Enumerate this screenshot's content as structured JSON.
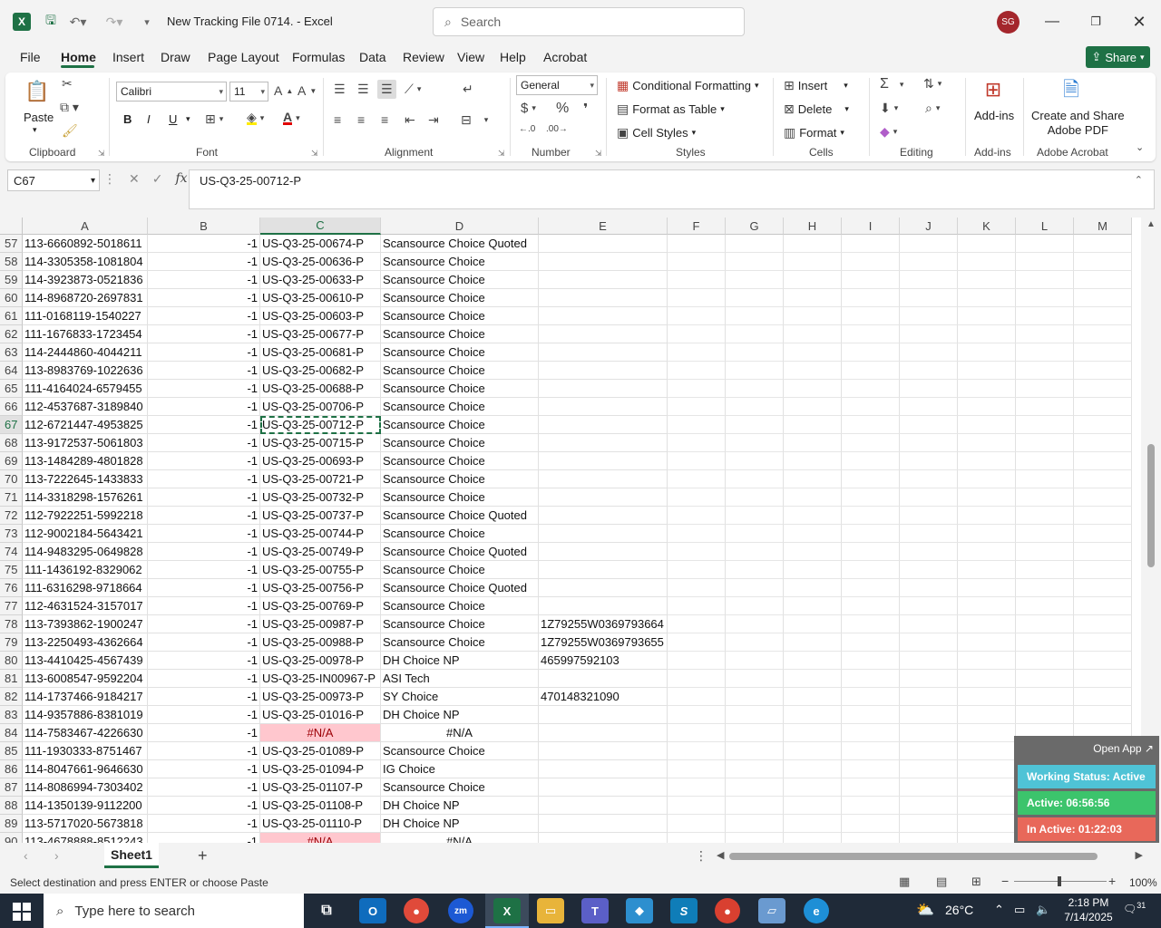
{
  "titlebar": {
    "doc_title": "New Tracking File 0714.  -  Excel",
    "search_placeholder": "Search",
    "avatar": "SG"
  },
  "menu": [
    "File",
    "Home",
    "Insert",
    "Draw",
    "Page Layout",
    "Formulas",
    "Data",
    "Review",
    "View",
    "Help",
    "Acrobat"
  ],
  "share_label": "Share",
  "ribbon": {
    "clipboard": {
      "paste": "Paste",
      "label": "Clipboard"
    },
    "font": {
      "name": "Calibri",
      "size": "11",
      "bold": "B",
      "italic": "I",
      "underline": "U",
      "label": "Font"
    },
    "alignment": {
      "label": "Alignment"
    },
    "number": {
      "format": "General",
      "label": "Number"
    },
    "styles": {
      "conditional": "Conditional Formatting",
      "table": "Format as Table",
      "cell_styles": "Cell Styles",
      "label": "Styles"
    },
    "cells": {
      "insert": "Insert",
      "delete": "Delete",
      "format": "Format",
      "label": "Cells"
    },
    "editing": {
      "label": "Editing"
    },
    "addins": {
      "btn": "Add-ins",
      "label": "Add-ins"
    },
    "acrobat": {
      "btn_line1": "Create and Share",
      "btn_line2": "Adobe PDF",
      "label": "Adobe Acrobat"
    }
  },
  "formula_bar": {
    "name_box": "C67",
    "value": "US-Q3-25-00712-P"
  },
  "columns": [
    "A",
    "B",
    "C",
    "D",
    "E",
    "F",
    "G",
    "H",
    "I",
    "J",
    "K",
    "L",
    "M"
  ],
  "selected_cell": {
    "row": 67,
    "col": "C"
  },
  "rows": [
    {
      "n": "57",
      "a": "113-6660892-5018611",
      "b": "-1",
      "c": "US-Q3-25-00674-P",
      "d": "Scansource Choice Quoted",
      "e": ""
    },
    {
      "n": "58",
      "a": "114-3305358-1081804",
      "b": "-1",
      "c": "US-Q3-25-00636-P",
      "d": "Scansource Choice",
      "e": ""
    },
    {
      "n": "59",
      "a": "114-3923873-0521836",
      "b": "-1",
      "c": "US-Q3-25-00633-P",
      "d": "Scansource Choice",
      "e": ""
    },
    {
      "n": "60",
      "a": "114-8968720-2697831",
      "b": "-1",
      "c": "US-Q3-25-00610-P",
      "d": "Scansource Choice",
      "e": ""
    },
    {
      "n": "61",
      "a": "111-0168119-1540227",
      "b": "-1",
      "c": "US-Q3-25-00603-P",
      "d": "Scansource Choice",
      "e": ""
    },
    {
      "n": "62",
      "a": "111-1676833-1723454",
      "b": "-1",
      "c": "US-Q3-25-00677-P",
      "d": "Scansource Choice",
      "e": ""
    },
    {
      "n": "63",
      "a": "114-2444860-4044211",
      "b": "-1",
      "c": "US-Q3-25-00681-P",
      "d": "Scansource Choice",
      "e": ""
    },
    {
      "n": "64",
      "a": "113-8983769-1022636",
      "b": "-1",
      "c": "US-Q3-25-00682-P",
      "d": "Scansource Choice",
      "e": ""
    },
    {
      "n": "65",
      "a": "111-4164024-6579455",
      "b": "-1",
      "c": "US-Q3-25-00688-P",
      "d": "Scansource Choice",
      "e": ""
    },
    {
      "n": "66",
      "a": "112-4537687-3189840",
      "b": "-1",
      "c": "US-Q3-25-00706-P",
      "d": "Scansource Choice",
      "e": ""
    },
    {
      "n": "67",
      "a": "112-6721447-4953825",
      "b": "-1",
      "c": "US-Q3-25-00712-P",
      "d": "Scansource Choice",
      "e": ""
    },
    {
      "n": "68",
      "a": "113-9172537-5061803",
      "b": "-1",
      "c": "US-Q3-25-00715-P",
      "d": "Scansource Choice",
      "e": ""
    },
    {
      "n": "69",
      "a": "113-1484289-4801828",
      "b": "-1",
      "c": "US-Q3-25-00693-P",
      "d": "Scansource Choice",
      "e": ""
    },
    {
      "n": "70",
      "a": "113-7222645-1433833",
      "b": "-1",
      "c": "US-Q3-25-00721-P",
      "d": "Scansource Choice",
      "e": ""
    },
    {
      "n": "71",
      "a": "114-3318298-1576261",
      "b": "-1",
      "c": "US-Q3-25-00732-P",
      "d": "Scansource Choice",
      "e": ""
    },
    {
      "n": "72",
      "a": "112-7922251-5992218",
      "b": "-1",
      "c": "US-Q3-25-00737-P",
      "d": "Scansource Choice Quoted",
      "e": ""
    },
    {
      "n": "73",
      "a": "112-9002184-5643421",
      "b": "-1",
      "c": "US-Q3-25-00744-P",
      "d": "Scansource Choice",
      "e": ""
    },
    {
      "n": "74",
      "a": "114-9483295-0649828",
      "b": "-1",
      "c": "US-Q3-25-00749-P",
      "d": "Scansource Choice Quoted",
      "e": ""
    },
    {
      "n": "75",
      "a": "111-1436192-8329062",
      "b": "-1",
      "c": "US-Q3-25-00755-P",
      "d": "Scansource Choice",
      "e": ""
    },
    {
      "n": "76",
      "a": "111-6316298-9718664",
      "b": "-1",
      "c": "US-Q3-25-00756-P",
      "d": "Scansource Choice Quoted",
      "e": ""
    },
    {
      "n": "77",
      "a": "112-4631524-3157017",
      "b": "-1",
      "c": "US-Q3-25-00769-P",
      "d": "Scansource Choice",
      "e": ""
    },
    {
      "n": "78",
      "a": "113-7393862-1900247",
      "b": "-1",
      "c": "US-Q3-25-00987-P",
      "d": "Scansource Choice",
      "e": "1Z79255W0369793664"
    },
    {
      "n": "79",
      "a": "113-2250493-4362664",
      "b": "-1",
      "c": "US-Q3-25-00988-P",
      "d": "Scansource Choice",
      "e": "1Z79255W0369793655"
    },
    {
      "n": "80",
      "a": "113-4410425-4567439",
      "b": "-1",
      "c": "US-Q3-25-00978-P",
      "d": "DH Choice NP",
      "e": "465997592103"
    },
    {
      "n": "81",
      "a": "113-6008547-9592204",
      "b": "-1",
      "c": "US-Q3-25-IN00967-P",
      "d": "ASI Tech",
      "e": ""
    },
    {
      "n": "82",
      "a": "114-1737466-9184217",
      "b": "-1",
      "c": "US-Q3-25-00973-P",
      "d": "SY Choice",
      "e": "470148321090"
    },
    {
      "n": "83",
      "a": "114-9357886-8381019",
      "b": "-1",
      "c": "US-Q3-25-01016-P",
      "d": "DH Choice NP",
      "e": ""
    },
    {
      "n": "84",
      "a": "114-7583467-4226630",
      "b": "-1",
      "c": "#N/A",
      "d": "#N/A",
      "e": ""
    },
    {
      "n": "85",
      "a": "111-1930333-8751467",
      "b": "-1",
      "c": "US-Q3-25-01089-P",
      "d": "Scansource Choice",
      "e": ""
    },
    {
      "n": "86",
      "a": "114-8047661-9646630",
      "b": "-1",
      "c": "US-Q3-25-01094-P",
      "d": "IG Choice",
      "e": ""
    },
    {
      "n": "87",
      "a": "114-8086994-7303402",
      "b": "-1",
      "c": "US-Q3-25-01107-P",
      "d": "Scansource Choice",
      "e": ""
    },
    {
      "n": "88",
      "a": "114-1350139-9112200",
      "b": "-1",
      "c": "US-Q3-25-01108-P",
      "d": "DH Choice NP",
      "e": ""
    },
    {
      "n": "89",
      "a": "113-5717020-5673818",
      "b": "-1",
      "c": "US-Q3-25-01110-P",
      "d": "DH Choice NP",
      "e": ""
    },
    {
      "n": "90",
      "a": "113-4678888-8512243",
      "b": "-1",
      "c": "#N/A",
      "d": "#N/A",
      "e": ""
    }
  ],
  "widget": {
    "open_app": "Open App ↗",
    "status": "Working Status: Active",
    "active": "Active: 06:56:56",
    "inactive": "In Active: 01:22:03"
  },
  "sheet_tab": "Sheet1",
  "status_text": "Select destination and press ENTER or choose Paste",
  "zoom": "100%",
  "taskbar": {
    "search_placeholder": "Type here to search",
    "temperature": "26°C",
    "time": "2:18 PM",
    "date": "7/14/2025",
    "notif_count": "31"
  }
}
